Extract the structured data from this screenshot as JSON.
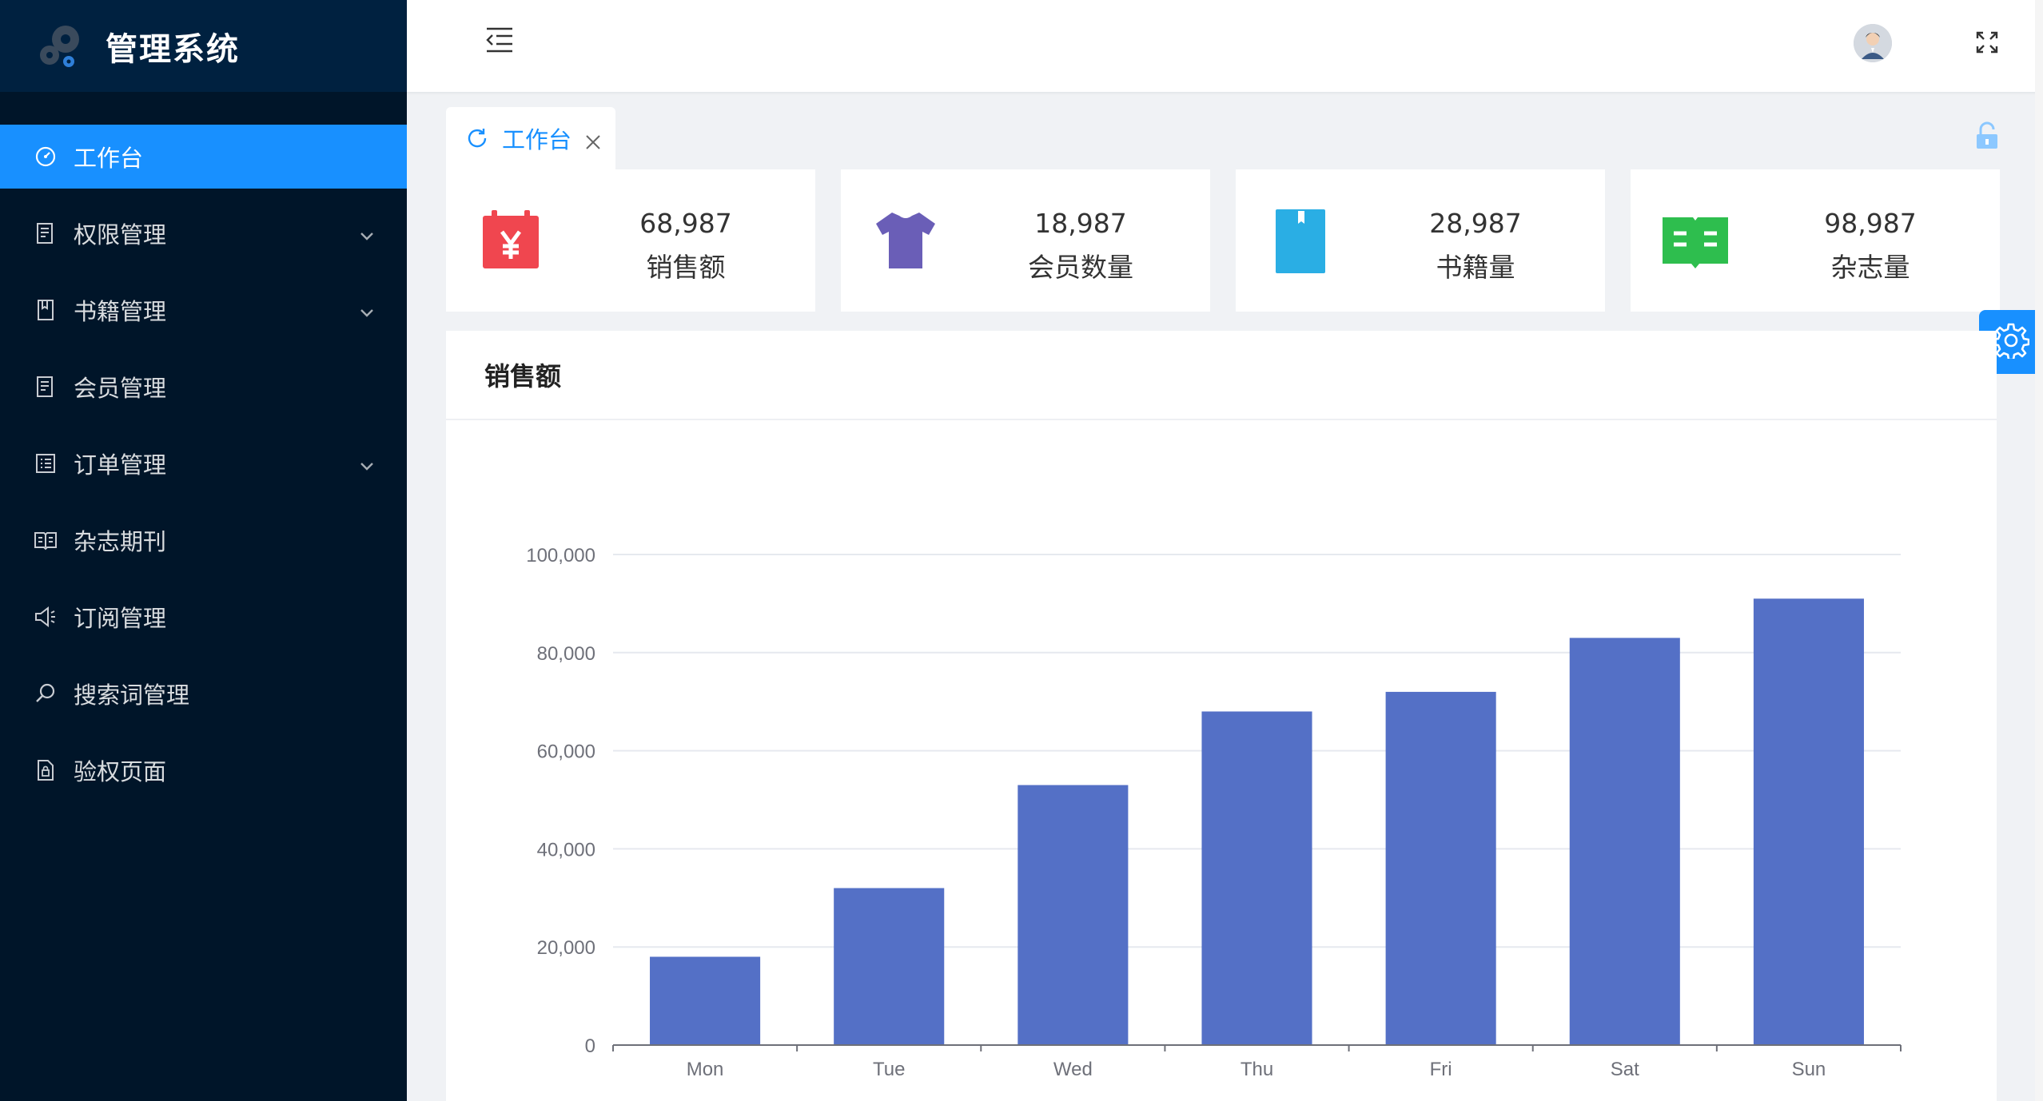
{
  "sidebar": {
    "title": "管理系统",
    "items": [
      {
        "label": "工作台",
        "icon": "dashboard-icon",
        "active": true,
        "expandable": false
      },
      {
        "label": "权限管理",
        "icon": "audit-icon",
        "active": false,
        "expandable": true
      },
      {
        "label": "书籍管理",
        "icon": "book-icon",
        "active": false,
        "expandable": true
      },
      {
        "label": "会员管理",
        "icon": "audit-icon",
        "active": false,
        "expandable": false
      },
      {
        "label": "订单管理",
        "icon": "list-icon",
        "active": false,
        "expandable": true
      },
      {
        "label": "杂志期刊",
        "icon": "read-icon",
        "active": false,
        "expandable": false
      },
      {
        "label": "订阅管理",
        "icon": "sound-icon",
        "active": false,
        "expandable": false
      },
      {
        "label": "搜索词管理",
        "icon": "search-icon",
        "active": false,
        "expandable": false
      },
      {
        "label": "验权页面",
        "icon": "file-lock-icon",
        "active": false,
        "expandable": false
      }
    ]
  },
  "tabs": [
    {
      "label": "工作台",
      "active": true
    }
  ],
  "stats": [
    {
      "value": "68,987",
      "label": "销售额",
      "icon": "calendar-yen-icon",
      "color": "#f0464f"
    },
    {
      "value": "18,987",
      "label": "会员数量",
      "icon": "shirt-icon",
      "color": "#6a5eb7"
    },
    {
      "value": "28,987",
      "label": "书籍量",
      "icon": "book-bookmark-icon",
      "color": "#2aaee4"
    },
    {
      "value": "98,987",
      "label": "杂志量",
      "icon": "open-book-icon",
      "color": "#2ebe4e"
    }
  ],
  "panel": {
    "title": "销售额"
  },
  "colors": {
    "sidebar": "#001529",
    "accent": "#1890ff",
    "bar": "#5470c6"
  },
  "chart_data": {
    "type": "bar",
    "title": "",
    "categories": [
      "Mon",
      "Tue",
      "Wed",
      "Thu",
      "Fri",
      "Sat",
      "Sun"
    ],
    "values": [
      18000,
      32000,
      53000,
      68000,
      72000,
      83000,
      91000
    ],
    "ylim": [
      0,
      100000
    ],
    "yticks": [
      "0",
      "20,000",
      "40,000",
      "60,000",
      "80,000",
      "100,000"
    ],
    "grid": true
  }
}
